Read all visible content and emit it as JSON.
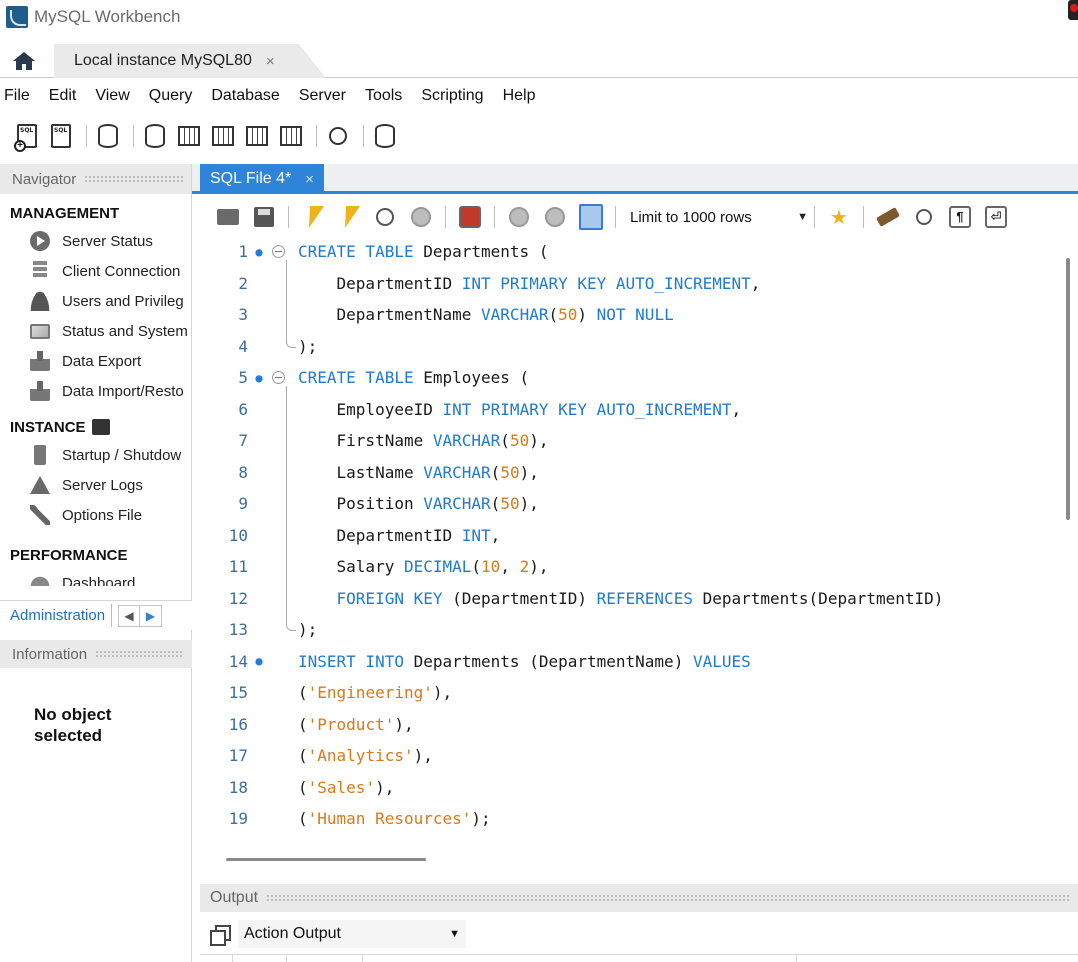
{
  "window": {
    "title": "MySQL Workbench"
  },
  "tabs": {
    "connection_tab": "Local instance MySQL80",
    "close": "×"
  },
  "menu": [
    "File",
    "Edit",
    "View",
    "Query",
    "Database",
    "Server",
    "Tools",
    "Scripting",
    "Help"
  ],
  "navigator": {
    "header": "Navigator",
    "management": {
      "title": "MANAGEMENT",
      "items": [
        "Server Status",
        "Client Connection",
        "Users and Privileg",
        "Status and System",
        "Data Export",
        "Data Import/Resto"
      ]
    },
    "instance": {
      "title": "INSTANCE",
      "items": [
        "Startup / Shutdow",
        "Server Logs",
        "Options File"
      ]
    },
    "performance": {
      "title": "PERFORMANCE",
      "items": [
        "Dashboard"
      ]
    },
    "tabs": {
      "administration": "Administration"
    }
  },
  "information": {
    "header": "Information",
    "empty_text": "No object selected"
  },
  "editor": {
    "tab_label": "SQL File 4*",
    "tab_close": "×",
    "limit_select": "Limit to 1000 rows",
    "lines": [
      {
        "n": "1",
        "mark": "●",
        "fold": true
      },
      {
        "n": "2"
      },
      {
        "n": "3"
      },
      {
        "n": "4"
      },
      {
        "n": "5",
        "mark": "●",
        "fold": true
      },
      {
        "n": "6"
      },
      {
        "n": "7"
      },
      {
        "n": "8"
      },
      {
        "n": "9"
      },
      {
        "n": "10"
      },
      {
        "n": "11"
      },
      {
        "n": "12"
      },
      {
        "n": "13"
      },
      {
        "n": "14",
        "mark": "●"
      },
      {
        "n": "15"
      },
      {
        "n": "16"
      },
      {
        "n": "17"
      },
      {
        "n": "18"
      },
      {
        "n": "19"
      }
    ],
    "code": [
      [
        [
          "kw",
          "CREATE TABLE"
        ],
        [
          "t",
          " Departments ("
        ]
      ],
      [
        [
          "t",
          "    DepartmentID "
        ],
        [
          "kw",
          "INT PRIMARY KEY AUTO_INCREMENT"
        ],
        [
          "t",
          ","
        ]
      ],
      [
        [
          "t",
          "    DepartmentName "
        ],
        [
          "kw",
          "VARCHAR"
        ],
        [
          "t",
          "("
        ],
        [
          "num",
          "50"
        ],
        [
          "t",
          ") "
        ],
        [
          "kw",
          "NOT NULL"
        ]
      ],
      [
        [
          "t",
          ");"
        ]
      ],
      [
        [
          "kw",
          "CREATE TABLE"
        ],
        [
          "t",
          " Employees ("
        ]
      ],
      [
        [
          "t",
          "    EmployeeID "
        ],
        [
          "kw",
          "INT PRIMARY KEY AUTO_INCREMENT"
        ],
        [
          "t",
          ","
        ]
      ],
      [
        [
          "t",
          "    FirstName "
        ],
        [
          "kw",
          "VARCHAR"
        ],
        [
          "t",
          "("
        ],
        [
          "num",
          "50"
        ],
        [
          "t",
          "),"
        ]
      ],
      [
        [
          "t",
          "    LastName "
        ],
        [
          "kw",
          "VARCHAR"
        ],
        [
          "t",
          "("
        ],
        [
          "num",
          "50"
        ],
        [
          "t",
          "),"
        ]
      ],
      [
        [
          "t",
          "    Position "
        ],
        [
          "kw",
          "VARCHAR"
        ],
        [
          "t",
          "("
        ],
        [
          "num",
          "50"
        ],
        [
          "t",
          "),"
        ]
      ],
      [
        [
          "t",
          "    DepartmentID "
        ],
        [
          "kw",
          "INT"
        ],
        [
          "t",
          ","
        ]
      ],
      [
        [
          "t",
          "    Salary "
        ],
        [
          "kw",
          "DECIMAL"
        ],
        [
          "t",
          "("
        ],
        [
          "num",
          "10"
        ],
        [
          "t",
          ", "
        ],
        [
          "num",
          "2"
        ],
        [
          "t",
          "),"
        ]
      ],
      [
        [
          "t",
          "    "
        ],
        [
          "kw",
          "FOREIGN KEY"
        ],
        [
          "t",
          " (DepartmentID) "
        ],
        [
          "kw",
          "REFERENCES"
        ],
        [
          "t",
          " Departments(DepartmentID)"
        ]
      ],
      [
        [
          "t",
          ");"
        ]
      ],
      [
        [
          "kw",
          "INSERT INTO"
        ],
        [
          "t",
          " Departments (DepartmentName) "
        ],
        [
          "kw",
          "VALUES"
        ]
      ],
      [
        [
          "t",
          "("
        ],
        [
          "str",
          "'Engineering'"
        ],
        [
          "t",
          "),"
        ]
      ],
      [
        [
          "t",
          "("
        ],
        [
          "str",
          "'Product'"
        ],
        [
          "t",
          "),"
        ]
      ],
      [
        [
          "t",
          "("
        ],
        [
          "str",
          "'Analytics'"
        ],
        [
          "t",
          "),"
        ]
      ],
      [
        [
          "t",
          "("
        ],
        [
          "str",
          "'Sales'"
        ],
        [
          "t",
          "),"
        ]
      ],
      [
        [
          "t",
          "("
        ],
        [
          "str",
          "'Human Resources'"
        ],
        [
          "t",
          ");"
        ]
      ]
    ]
  },
  "output": {
    "header": "Output",
    "select_value": "Action Output"
  },
  "colors": {
    "accent": "#2d84d8",
    "keyword": "#1f7ad1",
    "literal": "#d8791a"
  }
}
